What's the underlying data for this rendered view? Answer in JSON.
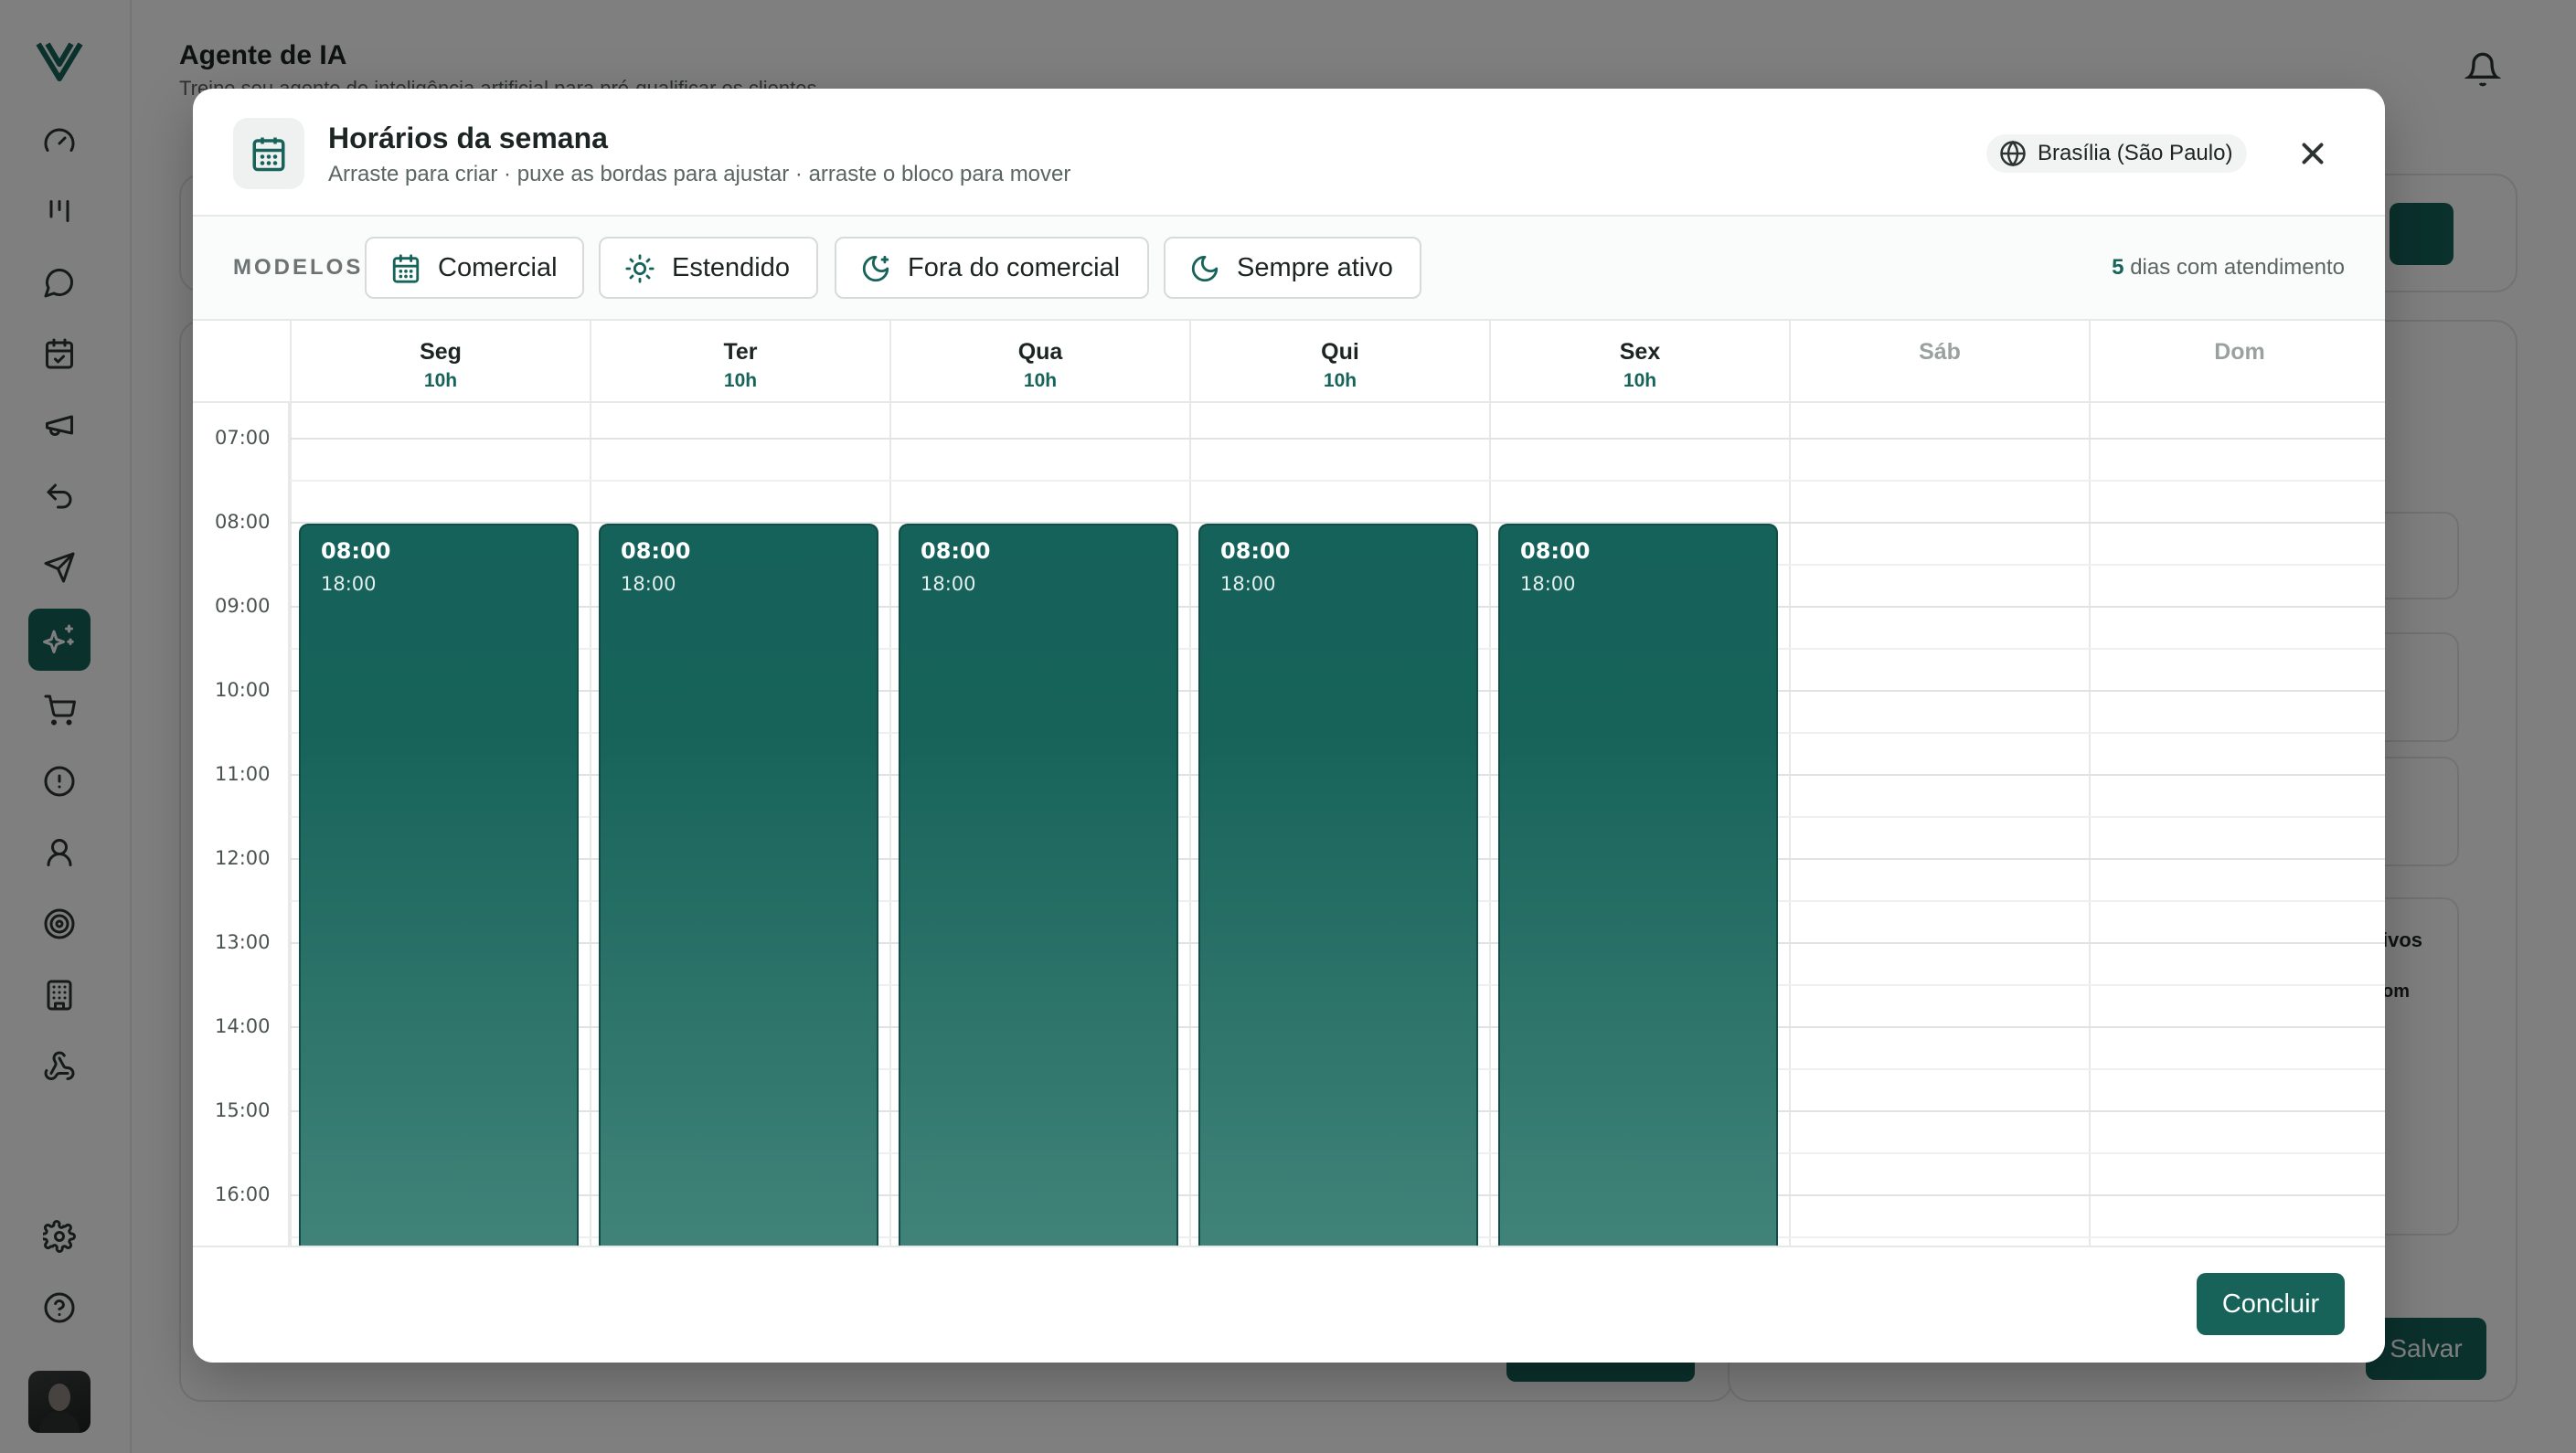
{
  "app": {
    "header_title": "Agente de IA",
    "header_subtitle": "Treine seu agente de inteligência artificial para pré-qualificar os clientes",
    "save_label": "Salvar",
    "side_text_1": "ivos",
    "side_text_2": "om",
    "sidebar_icons": [
      "dashboard-icon",
      "kanban-icon",
      "chat-icon",
      "calendar-icon",
      "megaphone-icon",
      "reply-icon",
      "send-icon",
      "sparkles-icon",
      "cart-icon",
      "alert-icon",
      "user-icon",
      "target-icon",
      "building-icon",
      "webhook-icon",
      "settings-icon",
      "help-icon"
    ],
    "active_icon": "sparkles-icon"
  },
  "modal": {
    "title": "Horários da semana",
    "subtitle": "Arraste para criar · puxe as bordas para ajustar · arraste o bloco para mover",
    "timezone": "Brasília (São Paulo)",
    "models_label": "MODELOS",
    "templates": [
      {
        "label": "Comercial",
        "icon": "calendar-icon"
      },
      {
        "label": "Estendido",
        "icon": "sun-icon"
      },
      {
        "label": "Fora do comercial",
        "icon": "moon-star-icon"
      },
      {
        "label": "Sempre ativo",
        "icon": "moon-icon"
      }
    ],
    "days_count_number": "5",
    "days_count_text": "dias com atendimento",
    "done_label": "Concluir"
  },
  "calendar": {
    "days": [
      {
        "name": "Seg",
        "hours": "10h",
        "active": true
      },
      {
        "name": "Ter",
        "hours": "10h",
        "active": true
      },
      {
        "name": "Qua",
        "hours": "10h",
        "active": true
      },
      {
        "name": "Qui",
        "hours": "10h",
        "active": true
      },
      {
        "name": "Sex",
        "hours": "10h",
        "active": true
      },
      {
        "name": "Sáb",
        "hours": "",
        "active": false
      },
      {
        "name": "Dom",
        "hours": "",
        "active": false
      }
    ],
    "time_labels": [
      "07:00",
      "08:00",
      "09:00",
      "10:00",
      "11:00",
      "12:00",
      "13:00",
      "14:00",
      "15:00",
      "16:00"
    ],
    "blocks": [
      {
        "day": 0,
        "start": "08:00",
        "end": "18:00"
      },
      {
        "day": 1,
        "start": "08:00",
        "end": "18:00"
      },
      {
        "day": 2,
        "start": "08:00",
        "end": "18:00"
      },
      {
        "day": 3,
        "start": "08:00",
        "end": "18:00"
      },
      {
        "day": 4,
        "start": "08:00",
        "end": "18:00"
      }
    ]
  }
}
